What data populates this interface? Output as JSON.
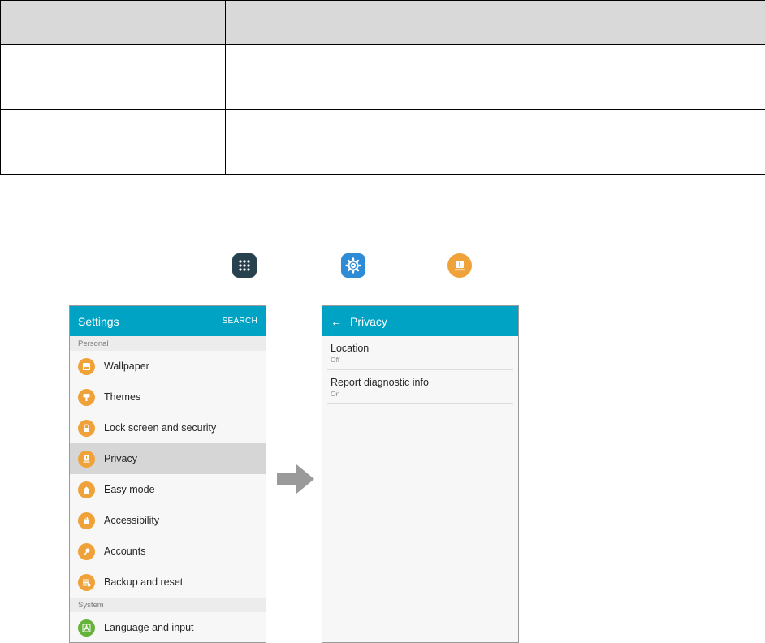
{
  "table": {
    "header": [
      "",
      ""
    ],
    "rows": [
      [
        "",
        ""
      ],
      [
        "",
        ""
      ]
    ]
  },
  "icons": {
    "apps": "apps-grid-icon",
    "settings": "settings-gear-icon",
    "privacy": "privacy-icon"
  },
  "settings_screen": {
    "title": "Settings",
    "search_label": "SEARCH",
    "sections": [
      {
        "header": "Personal",
        "items": [
          {
            "label": "Wallpaper",
            "icon": "wallpaper-icon"
          },
          {
            "label": "Themes",
            "icon": "themes-icon"
          },
          {
            "label": "Lock screen and security",
            "icon": "lock-icon"
          },
          {
            "label": "Privacy",
            "icon": "privacy-icon",
            "selected": true
          },
          {
            "label": "Easy mode",
            "icon": "easy-mode-icon"
          },
          {
            "label": "Accessibility",
            "icon": "accessibility-icon"
          },
          {
            "label": "Accounts",
            "icon": "key-icon"
          },
          {
            "label": "Backup and reset",
            "icon": "backup-icon"
          }
        ]
      },
      {
        "header": "System",
        "items": [
          {
            "label": "Language and input",
            "icon": "language-icon"
          }
        ]
      }
    ]
  },
  "privacy_screen": {
    "title": "Privacy",
    "items": [
      {
        "title": "Location",
        "status": "Off"
      },
      {
        "title": "Report diagnostic info",
        "status": "On"
      }
    ]
  },
  "colors": {
    "appbar": "#00a3c4",
    "item_icon": "#f0a23a",
    "language_icon": "#65b33a",
    "selected_row": "#d6d6d6"
  }
}
